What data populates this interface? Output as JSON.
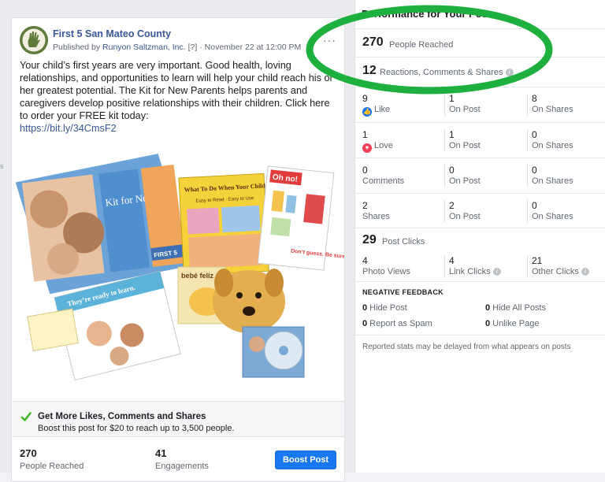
{
  "page": {
    "edge_text": "s"
  },
  "post": {
    "page_name": "First 5 San Mateo County",
    "published_by_prefix": "Published by",
    "publisher": "Runyon Saltzman, Inc.",
    "help_marker": "[?]",
    "separator": "·",
    "date": "November 22 at 12:00 PM",
    "more_icon": "ellipsis-icon",
    "text": "Your child’s first years are very important. Good health, loving relationships, and opportunities to learn will help your child reach his or her greatest potential. The Kit for New Parents helps parents and caregivers develop positive relationships with their children. Click here to order your FREE kit today:",
    "link": "https://bit.ly/34CmsF2",
    "image_texts": {
      "kit_label": "Kit for New Parents",
      "book_title": "What To Do When Your Child Gets Sick",
      "book_subtitle": "Easy to Read · Easy to Use",
      "card_title": "Oh no!",
      "card_note": "Don’t guess. Be sure.",
      "booklet_title": "They’re ready to learn.",
      "small_book": "bebé feliz",
      "brand": "FIRST 5"
    },
    "boost": {
      "title": "Get More Likes, Comments and Shares",
      "subtitle": "Boost this post for $20 to reach up to 3,500 people.",
      "button_label": "Boost Post"
    },
    "stats": [
      {
        "value": "270",
        "label": "People Reached"
      },
      {
        "value": "41",
        "label": "Engagements"
      }
    ]
  },
  "performance": {
    "title": "Performance for Your Post",
    "reached": {
      "value": "270",
      "label": "People Reached"
    },
    "reactions": {
      "value": "12",
      "label": "Reactions, Comments & Shares"
    },
    "breakdown": [
      {
        "total": "9",
        "label": "Like",
        "icon": "like-icon",
        "on_post": "1",
        "on_post_label": "On Post",
        "on_shares": "8",
        "on_shares_label": "On Shares"
      },
      {
        "total": "1",
        "label": "Love",
        "icon": "love-icon",
        "on_post": "1",
        "on_post_label": "On Post",
        "on_shares": "0",
        "on_shares_label": "On Shares"
      },
      {
        "total": "0",
        "label": "Comments",
        "on_post": "0",
        "on_post_label": "On Post",
        "on_shares": "0",
        "on_shares_label": "On Shares"
      },
      {
        "total": "2",
        "label": "Shares",
        "on_post": "2",
        "on_post_label": "On Post",
        "on_shares": "0",
        "on_shares_label": "On Shares"
      }
    ],
    "post_clicks": {
      "value": "29",
      "label": "Post Clicks"
    },
    "clicks": [
      {
        "value": "4",
        "label": "Photo Views"
      },
      {
        "value": "4",
        "label": "Link Clicks"
      },
      {
        "value": "21",
        "label": "Other Clicks"
      }
    ],
    "negative": {
      "title": "NEGATIVE FEEDBACK",
      "items": [
        {
          "value": "0",
          "label": "Hide Post"
        },
        {
          "value": "0",
          "label": "Hide All Posts"
        },
        {
          "value": "0",
          "label": "Report as Spam"
        },
        {
          "value": "0",
          "label": "Unlike Page"
        }
      ]
    },
    "footnote": "Reported stats may be delayed from what appears on posts"
  },
  "annotation": {
    "color": "#1db03e",
    "shape": "ellipse"
  }
}
